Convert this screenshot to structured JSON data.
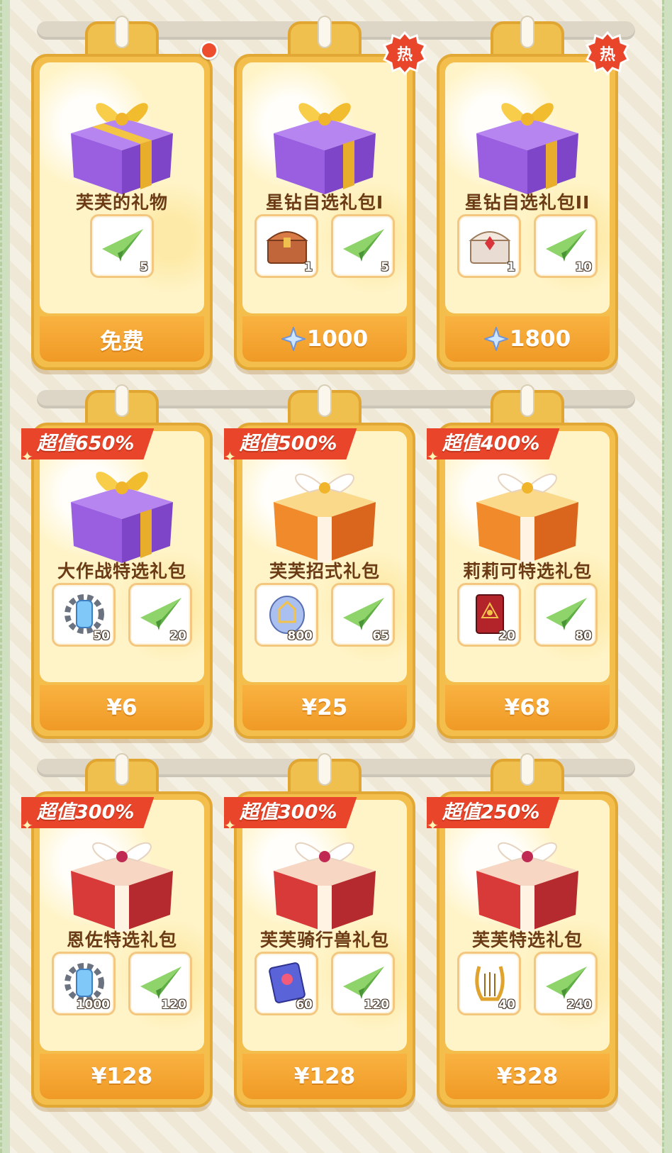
{
  "rows": [
    {
      "cards": [
        {
          "name": "芙芙的礼物",
          "box_icon": "purple-gift-box-icon",
          "price_label": "免费",
          "price_currency": "",
          "badge": "red-dot",
          "items": [
            {
              "icon": "paper-plane-icon",
              "qty": "5"
            }
          ]
        },
        {
          "name": "星钻自选礼包I",
          "box_icon": "purple-gift-box-icon",
          "price_label": "1000",
          "price_currency": "star-crystal-icon",
          "badge_text": "热",
          "items": [
            {
              "icon": "bronze-treasure-chest-icon",
              "qty": "1"
            },
            {
              "icon": "paper-plane-icon",
              "qty": "5"
            }
          ]
        },
        {
          "name": "星钻自选礼包II",
          "box_icon": "purple-gift-box-icon",
          "price_label": "1800",
          "price_currency": "star-crystal-icon",
          "badge_text": "热",
          "items": [
            {
              "icon": "ornate-treasure-chest-icon",
              "qty": "1"
            },
            {
              "icon": "paper-plane-icon",
              "qty": "10"
            }
          ]
        }
      ]
    },
    {
      "cards": [
        {
          "name": "大作战特选礼包",
          "box_icon": "purple-gift-box-icon",
          "value_tag": "超值650%",
          "price_label": "¥6",
          "items": [
            {
              "icon": "blue-gear-capsule-icon",
              "qty": "50"
            },
            {
              "icon": "paper-plane-icon",
              "qty": "20"
            }
          ]
        },
        {
          "name": "芙芙招式礼包",
          "box_icon": "orange-gift-box-icon",
          "value_tag": "超值500%",
          "price_label": "¥25",
          "items": [
            {
              "icon": "crystal-orb-icon",
              "qty": "800"
            },
            {
              "icon": "paper-plane-icon",
              "qty": "65"
            }
          ]
        },
        {
          "name": "莉莉可特选礼包",
          "box_icon": "orange-gift-box-icon",
          "value_tag": "超值400%",
          "price_label": "¥68",
          "items": [
            {
              "icon": "red-card-icon",
              "qty": "20"
            },
            {
              "icon": "paper-plane-icon",
              "qty": "80"
            }
          ]
        }
      ]
    },
    {
      "cards": [
        {
          "name": "恩佐特选礼包",
          "box_icon": "red-gift-box-icon",
          "value_tag": "超值300%",
          "price_label": "¥128",
          "items": [
            {
              "icon": "blue-gear-capsule-icon",
              "qty": "1000"
            },
            {
              "icon": "paper-plane-icon",
              "qty": "120"
            }
          ]
        },
        {
          "name": "芙芙骑行兽礼包",
          "box_icon": "red-gift-box-icon",
          "value_tag": "超值300%",
          "price_label": "¥128",
          "items": [
            {
              "icon": "ticket-card-icon",
              "qty": "60"
            },
            {
              "icon": "paper-plane-icon",
              "qty": "120"
            }
          ]
        },
        {
          "name": "芙芙特选礼包",
          "box_icon": "red-gift-box-icon",
          "value_tag": "超值250%",
          "price_label": "¥328",
          "items": [
            {
              "icon": "golden-lyre-icon",
              "qty": "40"
            },
            {
              "icon": "paper-plane-icon",
              "qty": "240"
            }
          ]
        }
      ]
    }
  ],
  "colors": {
    "card_frame": "#f3be4b",
    "price_bar": "#f09a26",
    "hot_badge": "#e8452a",
    "value_ribbon": "#e8452a",
    "name_text": "#6b3b16"
  }
}
